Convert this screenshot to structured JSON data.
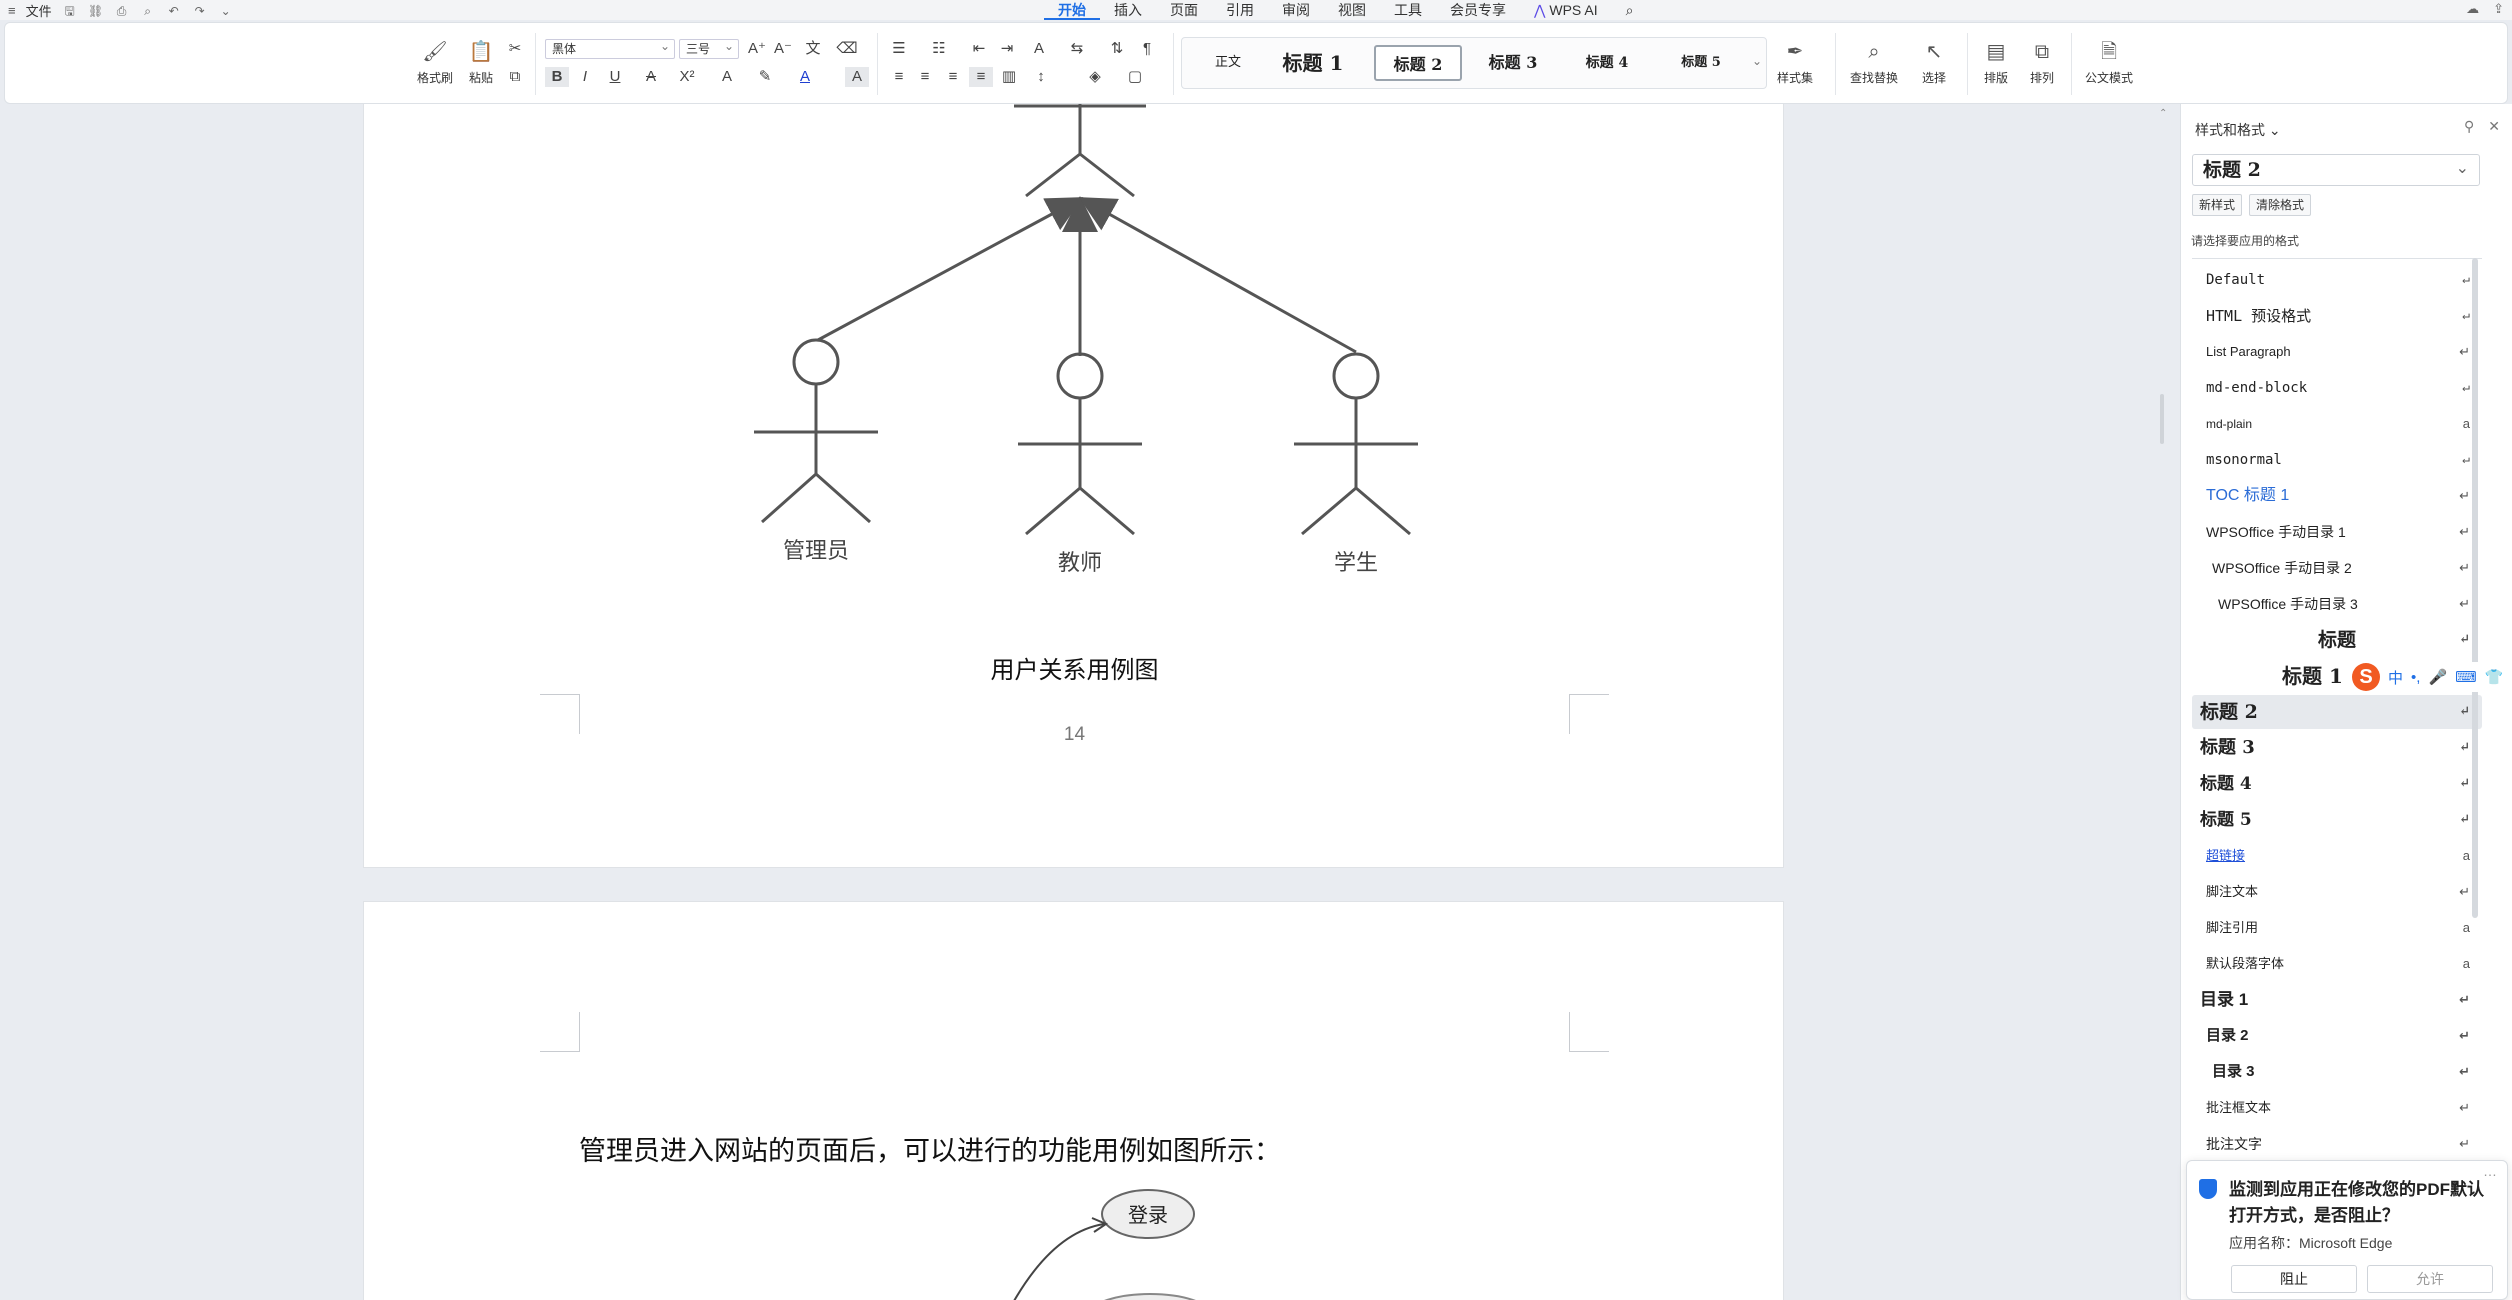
{
  "menubar": {
    "file_label": "文件",
    "tabs": [
      {
        "label": "开始",
        "active": true
      },
      {
        "label": "插入"
      },
      {
        "label": "页面"
      },
      {
        "label": "引用"
      },
      {
        "label": "审阅"
      },
      {
        "label": "视图"
      },
      {
        "label": "工具"
      },
      {
        "label": "会员专享"
      }
    ],
    "ai_label": "WPS AI"
  },
  "ribbon": {
    "format_painter": "格式刷",
    "paste": "粘贴",
    "font_name": "黑体",
    "font_size": "三号",
    "styles": [
      "正文",
      "标题 1",
      "标题 2",
      "标题 3",
      "标题 4",
      "标题 5"
    ],
    "style_set": "样式集",
    "find_replace": "查找替换",
    "select": "选择",
    "layout": "排版",
    "arrange": "排列",
    "official_mode": "公文模式"
  },
  "document": {
    "actors": [
      "管理员",
      "教师",
      "学生"
    ],
    "caption": "用户关系用例图",
    "page_number": "14",
    "paragraph": "管理员进入网站的页面后，可以进行的功能用例如图所示：",
    "usecase_login": "登录"
  },
  "panel": {
    "title": "样式和格式",
    "current_style": "标题 2",
    "new_style": "新样式",
    "clear_format": "清除格式",
    "hint": "请选择要应用的格式",
    "styles": [
      {
        "label": "Default",
        "mark": "↵"
      },
      {
        "label": "HTML 预设格式",
        "mark": "↵"
      },
      {
        "label": "List Paragraph",
        "mark": "↵"
      },
      {
        "label": "md-end-block",
        "mark": "↵"
      },
      {
        "label": "md-plain",
        "mark": "a"
      },
      {
        "label": "msonormal",
        "mark": "↵"
      },
      {
        "label": "TOC 标题 1",
        "mark": "↵"
      },
      {
        "label": "WPSOffice 手动目录 1",
        "mark": "↵"
      },
      {
        "label": "WPSOffice 手动目录 2",
        "mark": "↵"
      },
      {
        "label": "WPSOffice 手动目录 3",
        "mark": "↵"
      },
      {
        "label": "标题",
        "mark": "↵"
      },
      {
        "label": "标题 1",
        "mark": "↵"
      },
      {
        "label": "标题 2",
        "mark": "↵"
      },
      {
        "label": "标题 3",
        "mark": "↵"
      },
      {
        "label": "标题 4",
        "mark": "↵"
      },
      {
        "label": "标题 5",
        "mark": "↵"
      },
      {
        "label": "超链接",
        "mark": "a"
      },
      {
        "label": "脚注文本",
        "mark": "↵"
      },
      {
        "label": "脚注引用",
        "mark": "a"
      },
      {
        "label": "默认段落字体",
        "mark": "a"
      },
      {
        "label": "目录 1",
        "mark": "↵"
      },
      {
        "label": "目录 2",
        "mark": "↵"
      },
      {
        "label": "目录 3",
        "mark": "↵"
      },
      {
        "label": "批注框文本",
        "mark": "↵"
      },
      {
        "label": "批注文字",
        "mark": "↵"
      }
    ]
  },
  "ime": {
    "lang": "中"
  },
  "toast": {
    "message": "监测到应用正在修改您的PDF默认打开方式，是否阻止？",
    "app_name": "应用名称：Microsoft Edge",
    "block": "阻止",
    "allow": "允许"
  }
}
